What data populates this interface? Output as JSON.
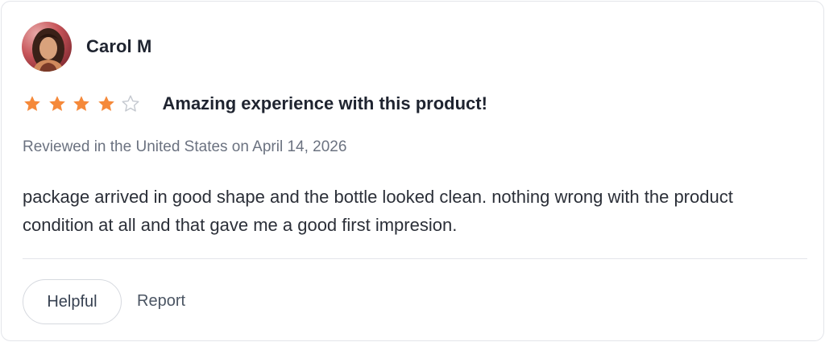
{
  "reviewer": {
    "name": "Carol M"
  },
  "review": {
    "rating": 4,
    "max_rating": 5,
    "title": "Amazing experience with this product!",
    "meta": "Reviewed in the United States on April 14, 2026",
    "body": "package arrived in good shape and the bottle looked clean. nothing wrong with the product condition at all and that gave me a good first impresion."
  },
  "actions": {
    "helpful_label": "Helpful",
    "report_label": "Report"
  },
  "colors": {
    "star_filled": "#f5893a",
    "star_empty_stroke": "#c4c8cf",
    "text_primary": "#1f2430",
    "text_muted": "#6b7280",
    "border": "#e3e5ea"
  },
  "icons": {
    "star_filled": "star-filled-icon",
    "star_empty": "star-empty-icon"
  }
}
